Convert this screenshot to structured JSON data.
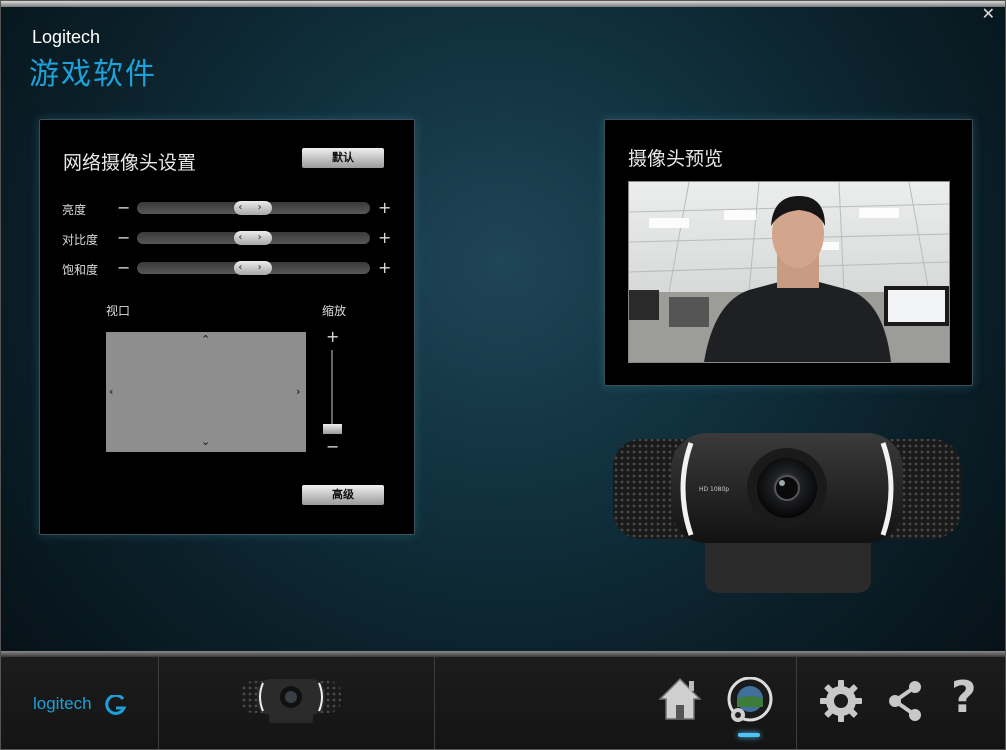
{
  "window": {
    "brand": "Logitech",
    "title": "游戏软件",
    "close_glyph": "✕"
  },
  "settings": {
    "title": "网络摄像头设置",
    "default_button": "默认",
    "advanced_button": "高级",
    "sliders": [
      {
        "label": "亮度",
        "value_fraction": 0.5
      },
      {
        "label": "对比度",
        "value_fraction": 0.5
      },
      {
        "label": "饱和度",
        "value_fraction": 0.5
      }
    ],
    "minus_glyph": "−",
    "plus_glyph": "+",
    "thumb_glyph": "‹ ›",
    "viewport_label": "视口",
    "zoom_label": "缩放",
    "zoom_plus": "+",
    "zoom_minus": "−",
    "zoom_value_fraction": 0.0,
    "arrows": {
      "up": "⌃",
      "down": "⌄",
      "left": "‹",
      "right": "›"
    }
  },
  "preview": {
    "title": "摄像头预览"
  },
  "webcam": {
    "badge": "HD 1080p"
  },
  "bottombar": {
    "logo_text": "logitech",
    "nav": [
      "home-icon",
      "camera-settings-icon",
      "gear-icon",
      "share-icon",
      "help-icon"
    ],
    "help_glyph": "?",
    "accent": "#1ea0d8"
  }
}
